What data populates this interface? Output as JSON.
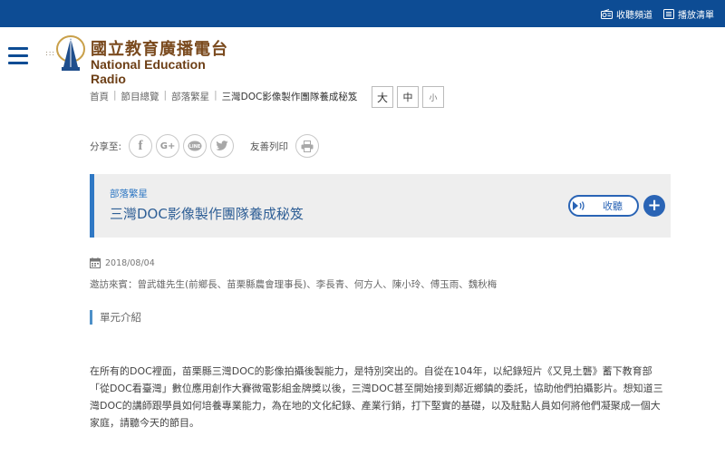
{
  "topbar": {
    "links": [
      {
        "icon": "radio-icon",
        "label": "收聽頻道"
      },
      {
        "icon": "playlist-icon",
        "label": "播放清單"
      }
    ]
  },
  "logo": {
    "dots": ":::",
    "name_cn": "國立教育廣播電台",
    "name_en": "National Education Radio"
  },
  "breadcrumb": {
    "items": [
      "首頁",
      "節目總覽",
      "部落繁星"
    ],
    "current": "三灣DOC影像製作團隊養成秘笈",
    "separator": "|"
  },
  "font_size": {
    "large": "大",
    "medium": "中",
    "small": "小"
  },
  "share": {
    "label": "分享至:",
    "buttons": [
      "f",
      "G+",
      "LINE",
      "twitter"
    ],
    "print_label": "友善列印"
  },
  "program": {
    "category": "部落繁星",
    "title": "三灣DOC影像製作團隊養成秘笈",
    "listen_label": "收聽",
    "add_label": "+"
  },
  "episode": {
    "date": "2018/08/04",
    "guests": "邀訪來賓：曾武雄先生(前鄉長、苗栗縣農會理事長)、李長青、何方人、陳小玲、傅玉雨、魏秋梅"
  },
  "section": {
    "heading": "單元介紹",
    "paragraph": "在所有的DOC裡面，苗栗縣三灣DOC的影像拍攝後製能力，是特別突出的。自從在104年，以紀錄短片《又見土礱》蓄下教育部「從DOC看臺灣」數位應用創作大賽微電影組金牌獎以後，三灣DOC甚至開始接到鄰近鄉鎮的委託，協助他們拍攝影片。想知道三灣DOC的講師跟學員如何培養專業能力，為在地的文化紀錄、產業行銷，打下堅實的基礎，以及駐點人員如何將他們凝聚成一個大家庭，請聽今天的節目。"
  },
  "colors": {
    "topbar": "#0d4c94",
    "accent": "#2a64b5",
    "logo_brown": "#7a4a1e"
  }
}
